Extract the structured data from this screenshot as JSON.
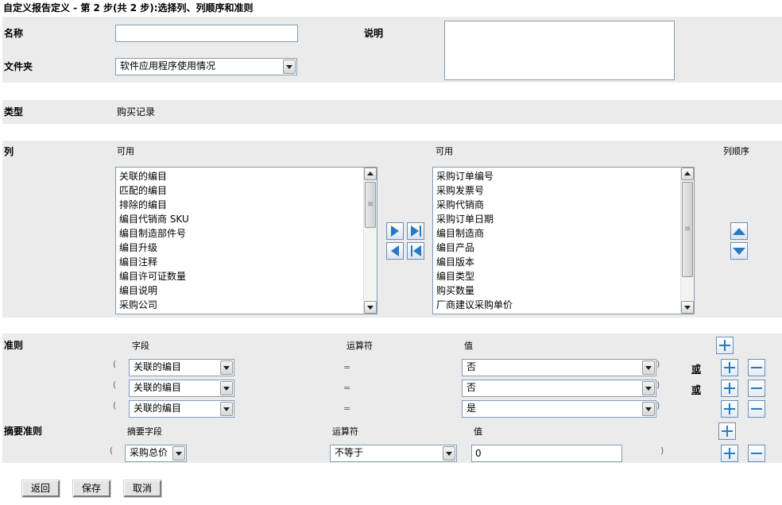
{
  "page_title": "自定义报告定义 - 第 2 步(共 2 步):选择列、列顺序和准则",
  "name": {
    "label": "名称",
    "value": ""
  },
  "description": {
    "label": "说明",
    "value": ""
  },
  "folder": {
    "label": "文件夹",
    "value": "软件应用程序使用情况"
  },
  "type": {
    "label": "类型",
    "value": "购买记录"
  },
  "columns": {
    "label": "列",
    "available_label": "可用",
    "selected_label": "可用",
    "order_label": "列顺序",
    "available_items": [
      "关联的编目",
      "匹配的编目",
      "排除的编目",
      "编目代销商 SKU",
      "编目制造部件号",
      "编目升级",
      "编目注释",
      "编目许可证数量",
      "编目说明",
      "采购公司"
    ],
    "selected_items": [
      "采购订单编号",
      "采购发票号",
      "采购代销商",
      "采购订单日期",
      "编目制造商",
      "编目产品",
      "编目版本",
      "编目类型",
      "购买数量",
      "厂商建议采购单价"
    ]
  },
  "criteria": {
    "label": "准则",
    "field_header": "字段",
    "operator_header": "运算符",
    "value_header": "值",
    "open_paren": "(",
    "close_paren": ")",
    "rows": [
      {
        "field": "关联的编目",
        "operator": "=",
        "value": "否",
        "connector": "或"
      },
      {
        "field": "关联的编目",
        "operator": "=",
        "value": "否",
        "connector": "或"
      },
      {
        "field": "关联的编目",
        "operator": "=",
        "value": "是",
        "connector": ""
      }
    ]
  },
  "summary_criteria": {
    "label": "摘要准则",
    "field_header": "摘要字段",
    "operator_header": "运算符",
    "value_header": "值",
    "open_paren": "(",
    "close_paren": ")",
    "row": {
      "field": "采购总价",
      "operator": "不等于",
      "value": "0"
    }
  },
  "buttons": {
    "back": "返回",
    "save": "保存",
    "cancel": "取消"
  }
}
